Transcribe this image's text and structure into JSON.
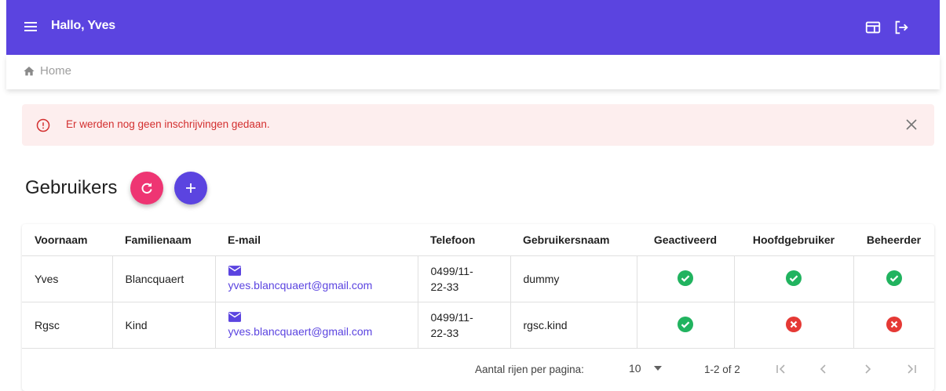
{
  "header": {
    "title": "Hallo, Yves"
  },
  "breadcrumb": {
    "home_label": "Home"
  },
  "alert": {
    "message": "Er werden nog geen inschrijvingen gedaan."
  },
  "page": {
    "title": "Gebruikers"
  },
  "table": {
    "columns": [
      "Voornaam",
      "Familienaam",
      "E-mail",
      "Telefoon",
      "Gebruikersnaam",
      "Geactiveerd",
      "Hoofdgebruiker",
      "Beheerder"
    ],
    "rows": [
      {
        "voornaam": "Yves",
        "familienaam": "Blancquaert",
        "email": "yves.blancquaert@gmail.com",
        "telefoon_line1": "0499/11-",
        "telefoon_line2": "22-33",
        "gebruikersnaam": "dummy",
        "geactiveerd": true,
        "hoofdgebruiker": true,
        "beheerder": true
      },
      {
        "voornaam": "Rgsc",
        "familienaam": "Kind",
        "email": "yves.blancquaert@gmail.com",
        "telefoon_line1": "0499/11-",
        "telefoon_line2": "22-33",
        "gebruikersnaam": "rgsc.kind",
        "geactiveerd": true,
        "hoofdgebruiker": false,
        "beheerder": false
      }
    ]
  },
  "pagination": {
    "rows_per_page_label": "Aantal rijen per pagina:",
    "rows_per_page_value": "10",
    "range": "1-2 of 2"
  },
  "icons": {
    "menu": "hamburger-menu-icon",
    "layout": "window-layout-icon",
    "logout": "logout-icon",
    "home": "home-icon",
    "alert": "error-circle-icon",
    "close": "close-icon",
    "refresh": "refresh-icon",
    "add": "plus-icon",
    "mail": "mail-icon",
    "check": "check-circle-icon",
    "cross": "cancel-circle-icon"
  },
  "colors": {
    "primary": "#5b44e0",
    "accent": "#ee3573",
    "success": "#21b35f",
    "error": "#e53935",
    "alert_bg": "#fdeeee",
    "alert_text": "#d32f2f"
  }
}
